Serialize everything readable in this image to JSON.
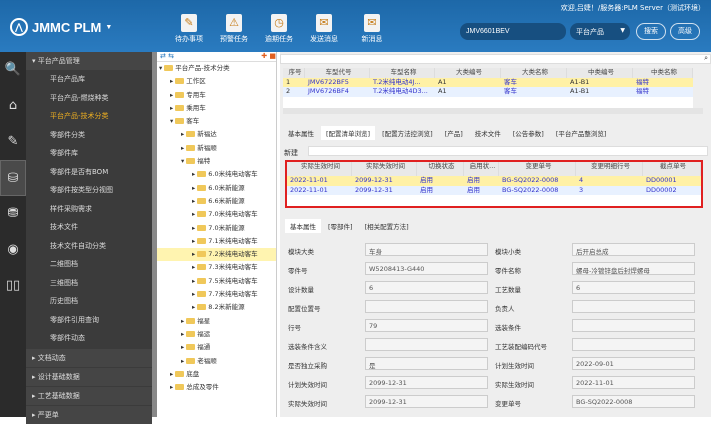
{
  "header": {
    "welcome": "欢迎,吕婕！/服务器:PLM Server（测试环境）",
    "logo": "JMMC PLM",
    "search_value": "JMV6601BEV",
    "scope": "平台产品",
    "search_btn": "搜索",
    "advanced_btn": "高级",
    "toolbar": [
      {
        "label": "待办事项",
        "icon": "notepad-icon"
      },
      {
        "label": "预警任务",
        "icon": "warning-doc-icon"
      },
      {
        "label": "逾期任务",
        "icon": "clock-doc-icon"
      },
      {
        "label": "发送消息",
        "icon": "send-mail-icon"
      },
      {
        "label": "新消息",
        "icon": "new-mail-icon"
      }
    ]
  },
  "rail": [
    "search-icon",
    "home-icon",
    "edit-icon",
    "database-gear-icon",
    "database-icon",
    "broadcast-icon",
    "book-icon"
  ],
  "sidebar": {
    "group": "平台产品管理",
    "items": [
      "平台产品库",
      "平台产品-燃烧种类",
      "平台产品-技术分类",
      "零部件分类",
      "零部件库",
      "零部件是否有BOM",
      "零部件按类型分视图",
      "样件采购需求",
      "技术文件",
      "技术文件自动分类",
      "二维图档",
      "三维图档",
      "历史图档",
      "零部件引用查询",
      "零部件动态"
    ],
    "active": 2,
    "groups": [
      "文档动态",
      "设计基础数据",
      "工艺基础数据",
      "严更单"
    ]
  },
  "tree": {
    "nodes": [
      {
        "l": "平台产品-技术分类",
        "d": 0
      },
      {
        "l": "工作区",
        "d": 1
      },
      {
        "l": "专用车",
        "d": 1
      },
      {
        "l": "乘用车",
        "d": 1
      },
      {
        "l": "客车",
        "d": 1
      },
      {
        "l": "新福达",
        "d": 2
      },
      {
        "l": "新福顺",
        "d": 2
      },
      {
        "l": "福特",
        "d": 2
      },
      {
        "l": "6.0米纯电动客车",
        "d": 3
      },
      {
        "l": "6.0米新能源",
        "d": 3
      },
      {
        "l": "6.6米新能源",
        "d": 3
      },
      {
        "l": "7.0米纯电动客车",
        "d": 3
      },
      {
        "l": "7.0米新能源",
        "d": 3
      },
      {
        "l": "7.1米纯电动客车",
        "d": 3
      },
      {
        "l": "7.2米纯电动客车",
        "d": 3
      },
      {
        "l": "7.3米纯电动客车",
        "d": 3
      },
      {
        "l": "7.5米纯电动客车",
        "d": 3
      },
      {
        "l": "7.7米纯电动客车",
        "d": 3
      },
      {
        "l": "8.2米新能源",
        "d": 3
      },
      {
        "l": "福星",
        "d": 2
      },
      {
        "l": "福运",
        "d": 2
      },
      {
        "l": "福通",
        "d": 2
      },
      {
        "l": "老福顺",
        "d": 2
      },
      {
        "l": "底盘",
        "d": 1
      },
      {
        "l": "总成及零件",
        "d": 1
      }
    ],
    "selected": 14
  },
  "top_grid": {
    "headers": [
      "序号",
      "车型代号",
      "车型名称",
      "大类编号",
      "大类名称",
      "中类编号",
      "中类名称"
    ],
    "rows": [
      [
        "1",
        "JMV6722BF5",
        "T.2米纯电动4J...",
        "A1",
        "客车",
        "A1-B1",
        "福特"
      ],
      [
        "2",
        "JMV6726BF4",
        "T.2米纯电动4D3...",
        "A1",
        "客车",
        "A1-B1",
        "福特"
      ]
    ]
  },
  "tabs1": [
    "基本属性",
    "[配置清单浏览]",
    "[配置方法控浏览]",
    "[产品]",
    "技术文件",
    "[公告参数]",
    "[平台产品整浏览]"
  ],
  "new_label": "新建",
  "config_grid": {
    "headers": [
      "实际生效时间",
      "实际失效时间",
      "切换状态",
      "启用状...",
      "变更单号",
      "变更明细行号",
      "截点单号"
    ],
    "rows": [
      [
        "2022-11-01",
        "2099-12-31",
        "启用",
        "启用",
        "BG-SQ2022-0008",
        "4",
        "DD00001"
      ],
      [
        "2022-11-01",
        "2099-12-31",
        "启用",
        "启用",
        "BG-SQ2022-0008",
        "3",
        "DD00002"
      ]
    ]
  },
  "tabs2": [
    "基本属性",
    "[零部件]",
    "[相关配置方法]"
  ],
  "form": [
    [
      "模块大类",
      "车身",
      "模块小类",
      "后开启总成"
    ],
    [
      "零件号",
      "W5208413-G440",
      "零件名称",
      "螺母-冷镀锌盘后封焊螺母"
    ],
    [
      "设计数量",
      "6",
      "工艺数量",
      "6"
    ],
    [
      "配置位置号",
      "",
      "负责人",
      ""
    ],
    [
      "行号",
      "79",
      "选装条件",
      ""
    ],
    [
      "选装条件含义",
      "",
      "工艺装配编码代号",
      ""
    ],
    [
      "是否独立采购",
      "是",
      "计划生效时间",
      "2022-09-01"
    ],
    [
      "计划失效时间",
      "2099-12-31",
      "实际生效时间",
      "2022-11-01"
    ],
    [
      "实际失效时间",
      "2099-12-31",
      "变更单号",
      "BG-SQ2022-0008"
    ]
  ]
}
